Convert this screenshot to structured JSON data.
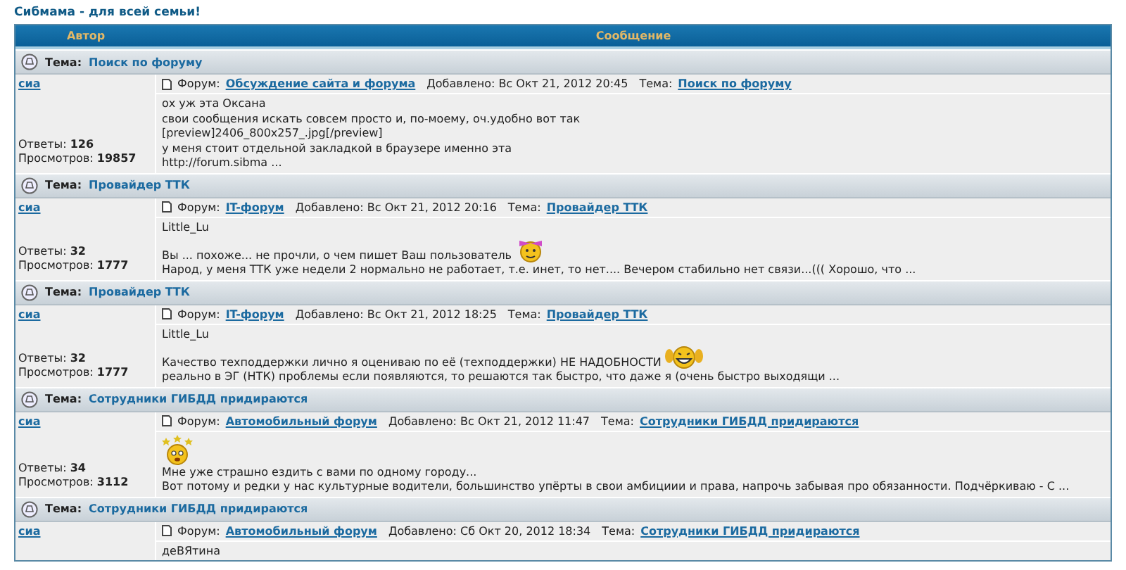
{
  "site_title": "Сибмама - для всей семьи!",
  "columns": [
    "Автор",
    "Сообщение"
  ],
  "posts": [
    {
      "topic_label": "Тема:",
      "topic": "Поиск по форуму",
      "author": "сиа",
      "replies_label": "Ответы:",
      "replies": "126",
      "views_label": "Просмотров:",
      "views": "19857",
      "forum_label": "Форум:",
      "forum": "Обсуждение сайта и форума",
      "added_label": "Добавлено:",
      "added": "Вс Окт 21, 2012 20:45",
      "topic_link_label": "Тема:",
      "topic_link": "Поиск по форуму",
      "body": [
        {
          "kind": "text",
          "text": "ох уж эта Оксана"
        },
        {
          "kind": "text",
          "text": "свои сообщения искать совсем просто и, по-моему, оч.удобно вот так"
        },
        {
          "kind": "text",
          "text": "[preview]2406_800x257_.jpg[/preview]"
        },
        {
          "kind": "text",
          "text": "у меня стоит отдельной закладкой в браузере именно эта"
        },
        {
          "kind": "text",
          "text": "http://forum.sibma ..."
        }
      ]
    },
    {
      "topic_label": "Тема:",
      "topic": "Провайдер ТТК",
      "author": "сиа",
      "replies_label": "Ответы:",
      "replies": "32",
      "views_label": "Просмотров:",
      "views": "1777",
      "forum_label": "Форум:",
      "forum": "IT-форум",
      "added_label": "Добавлено:",
      "added": "Вс Окт 21, 2012 20:16",
      "topic_link_label": "Тема:",
      "topic_link": "Провайдер ТТК",
      "body": [
        {
          "kind": "text",
          "text": "Little_Lu"
        },
        {
          "kind": "bow",
          "text": "Вы ... похоже... не прочли, о чем пишет Ваш пользователь"
        },
        {
          "kind": "text",
          "text": "Народ, у меня ТТК уже недели 2 нормально не работает, т.е. инет, то нет.... Вечером стабильно нет связи...((( Хорошо, что ..."
        }
      ]
    },
    {
      "topic_label": "Тема:",
      "topic": "Провайдер ТТК",
      "author": "сиа",
      "replies_label": "Ответы:",
      "replies": "32",
      "views_label": "Просмотров:",
      "views": "1777",
      "forum_label": "Форум:",
      "forum": "IT-форум",
      "added_label": "Добавлено:",
      "added": "Вс Окт 21, 2012 18:25",
      "topic_link_label": "Тема:",
      "topic_link": "Провайдер ТТК",
      "body": [
        {
          "kind": "text",
          "text": "Little_Lu"
        },
        {
          "kind": "laugh",
          "text": "Качество техподдержки лично я оцениваю по её (техподдержки) НЕ НАДОБНОСТИ"
        },
        {
          "kind": "text",
          "text": "реально в ЭГ (НТК) проблемы если появляются, то решаются так быстро, что даже я (очень быстро выходящи ..."
        }
      ]
    },
    {
      "topic_label": "Тема:",
      "topic": "Сотрудники ГИБДД придираются",
      "author": "сиа",
      "replies_label": "Ответы:",
      "replies": "34",
      "views_label": "Просмотров:",
      "views": "3112",
      "forum_label": "Форум:",
      "forum": "Автомобильный форум",
      "added_label": "Добавлено:",
      "added": "Вс Окт 21, 2012 11:47",
      "topic_link_label": "Тема:",
      "topic_link": "Сотрудники ГИБДД придираются",
      "body": [
        {
          "kind": "stars"
        },
        {
          "kind": "text",
          "text": "Мне уже страшно ездить с вами по одному городу..."
        },
        {
          "kind": "text",
          "text": "Вот потому и редки у нас культурные водители, большинство упёрты в свои амбициии и права, напрочь забывая про обязанности. Подчёркиваю - С ..."
        }
      ]
    },
    {
      "topic_label": "Тема:",
      "topic": "Сотрудники ГИБДД придираются",
      "author": "сиа",
      "forum_label": "Форум:",
      "forum": "Автомобильный форум",
      "added_label": "Добавлено:",
      "added": "Сб Окт 20, 2012 18:34",
      "topic_link_label": "Тема:",
      "topic_link": "Сотрудники ГИБДД придираются",
      "body": [
        {
          "kind": "text",
          "text": "деВЯтина"
        }
      ]
    }
  ]
}
